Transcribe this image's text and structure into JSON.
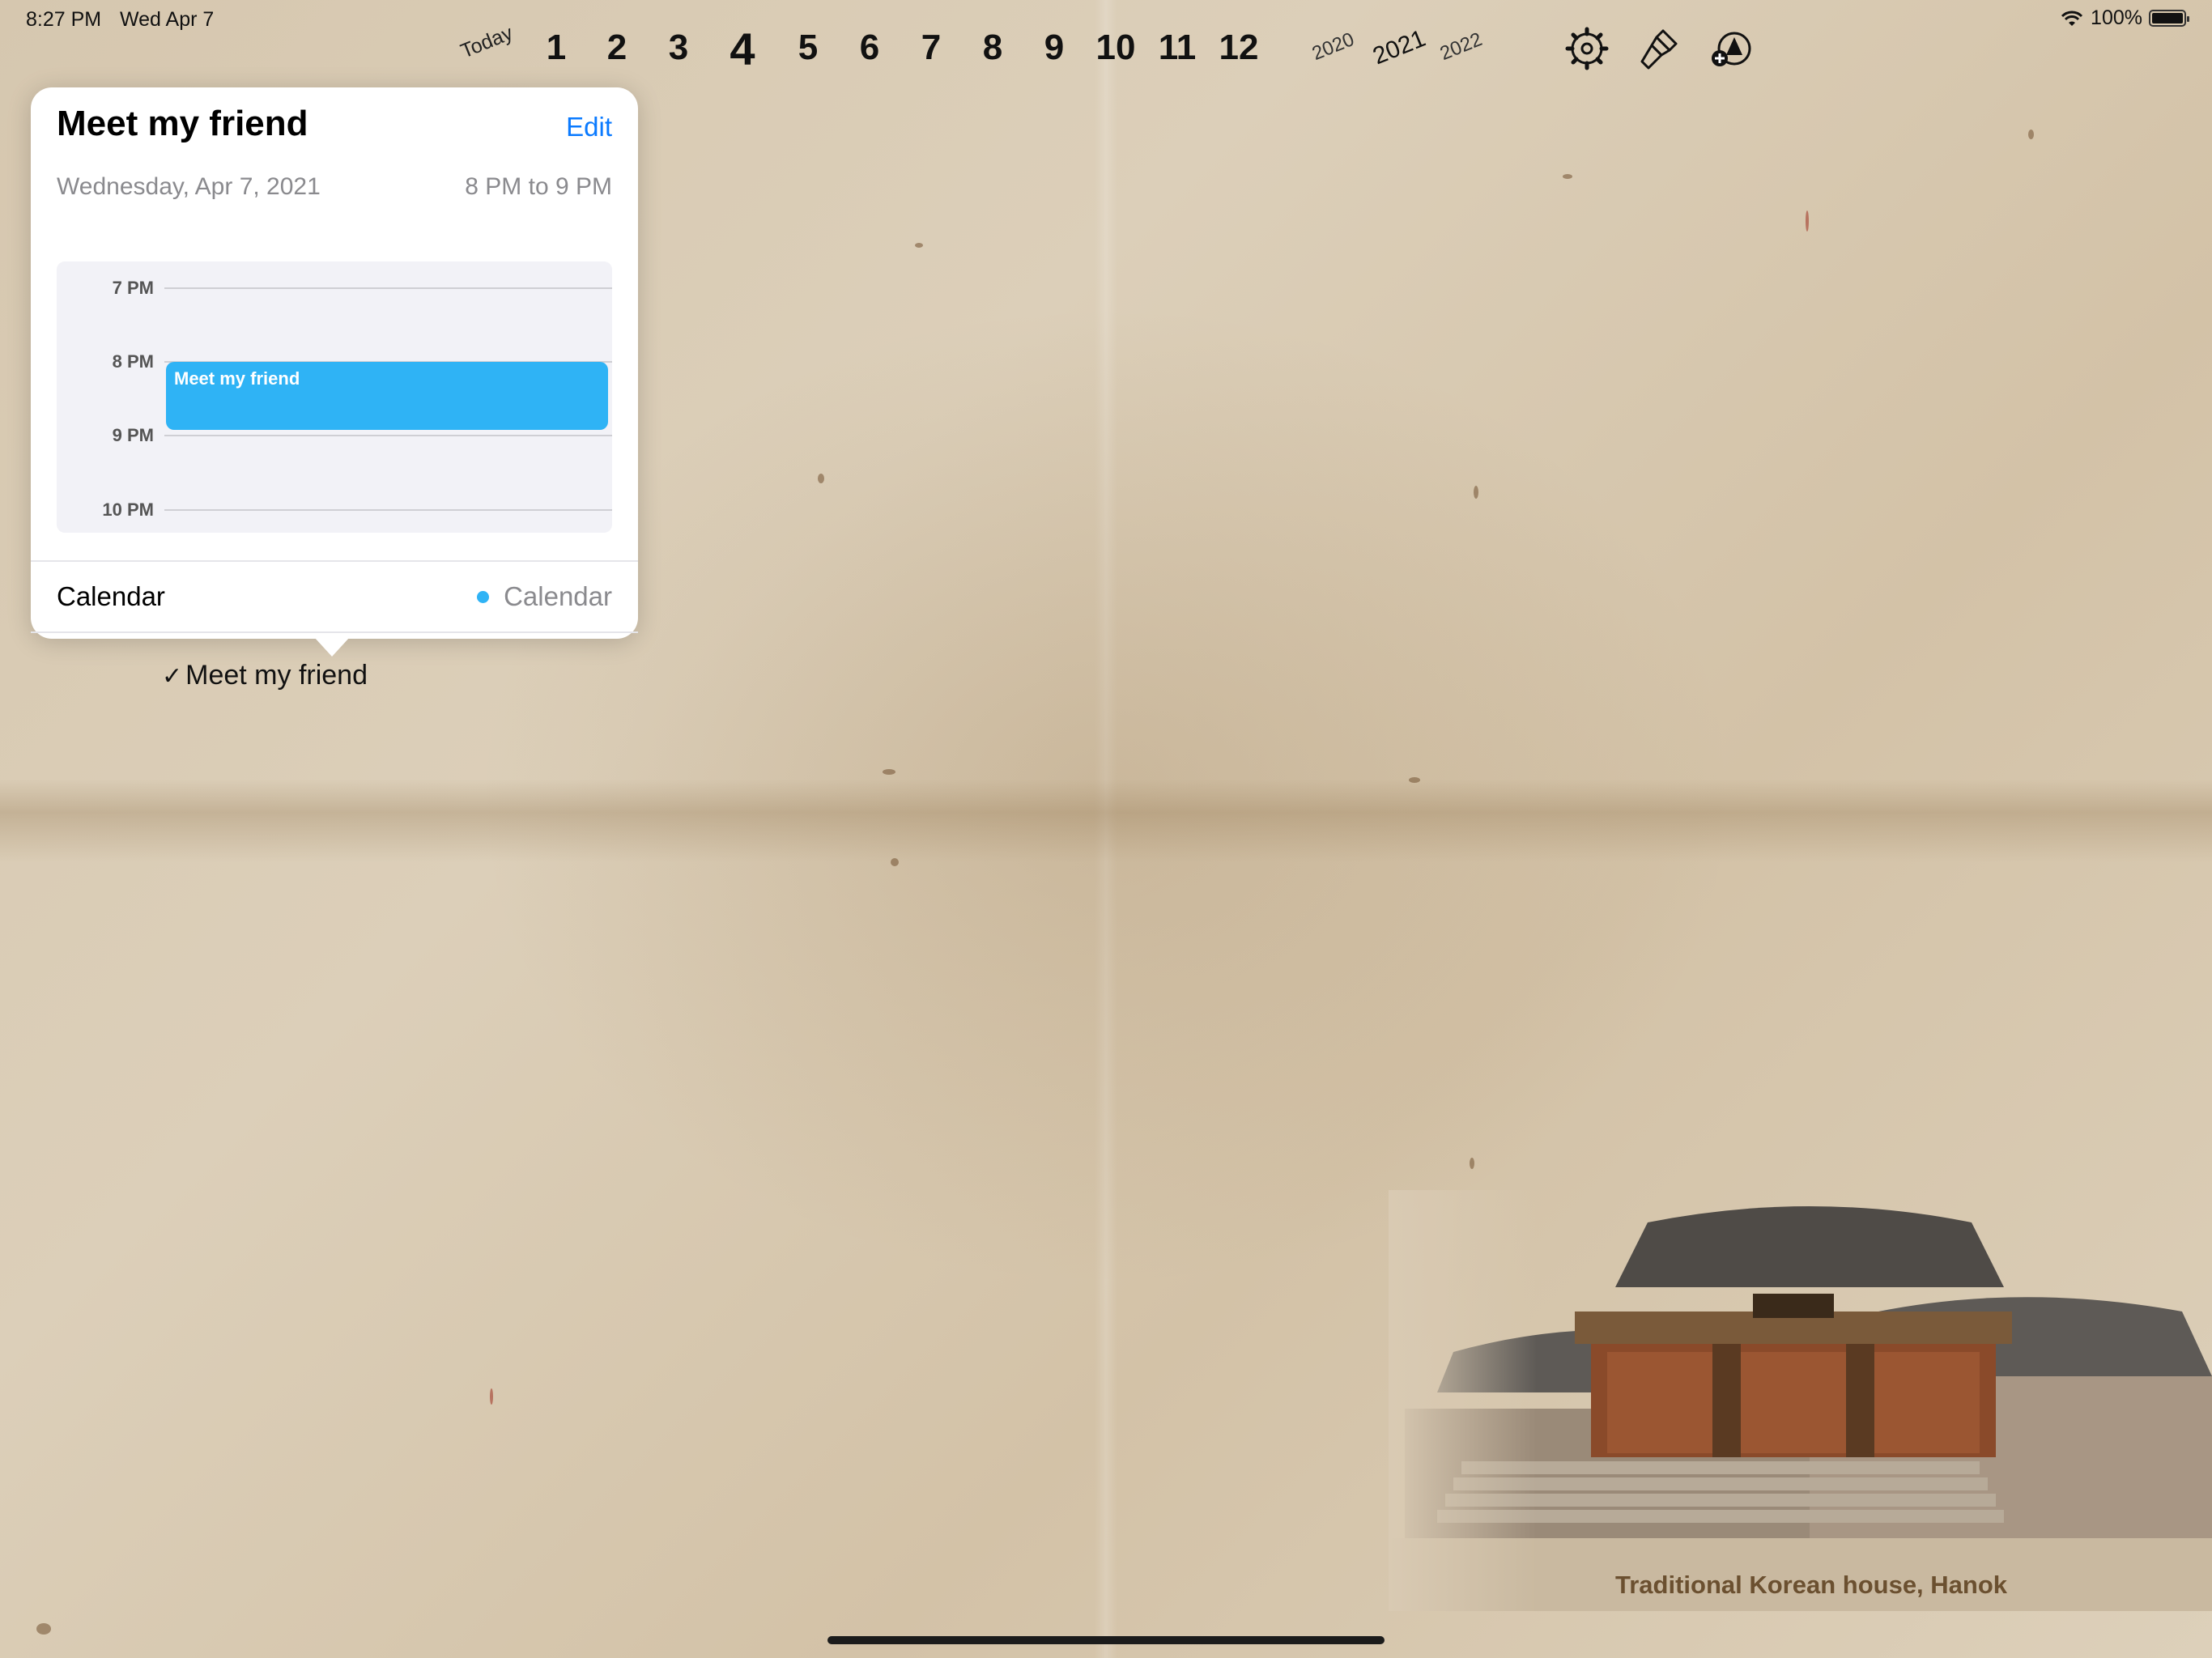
{
  "status_bar": {
    "time": "8:27 PM",
    "date": "Wed Apr 7",
    "battery": "100%",
    "battery_level": 1.0
  },
  "month_strip": {
    "today_label": "Today",
    "months": [
      "1",
      "2",
      "3",
      "4",
      "5",
      "6",
      "7",
      "8",
      "9",
      "10",
      "11",
      "12"
    ],
    "current_month": "4",
    "years": [
      "2020",
      "2021",
      "2022"
    ],
    "current_year": "2021"
  },
  "toolbar": {
    "icons": [
      "settings-icon",
      "paint-brush-icon",
      "add-shapes-icon"
    ]
  },
  "popover": {
    "title": "Meet my friend",
    "edit_label": "Edit",
    "date": "Wednesday, Apr 7, 2021",
    "time_range": "8 PM to 9 PM",
    "preview": {
      "hours": [
        "7 PM",
        "8 PM",
        "9 PM",
        "10 PM"
      ],
      "event_label": "Meet my friend",
      "event_color": "#2fb3f5"
    },
    "calendar_label": "Calendar",
    "calendar_value": "Calendar"
  },
  "event_entry": {
    "check": "✓",
    "title": "Meet my friend"
  },
  "illustration": {
    "caption": "Traditional Korean house, Hanok"
  },
  "colors": {
    "accent": "#0a7aff",
    "event": "#2fb3f5",
    "paper": "#d9cab3"
  }
}
